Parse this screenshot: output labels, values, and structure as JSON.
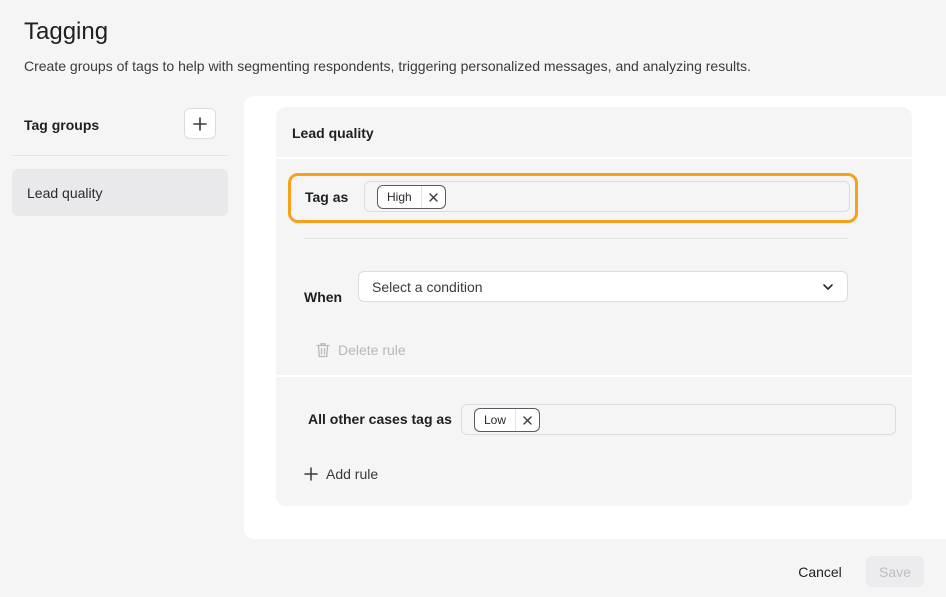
{
  "header": {
    "title": "Tagging",
    "subtitle": "Create groups of tags to help with segmenting respondents, triggering personalized messages, and analyzing results."
  },
  "sidebar": {
    "heading": "Tag groups",
    "add_icon": "plus-icon",
    "items": [
      {
        "label": "Lead quality",
        "selected": true
      }
    ]
  },
  "group": {
    "title": "Lead quality",
    "rule": {
      "tag_as_label": "Tag as",
      "tags": [
        {
          "label": "High",
          "remove_icon": "close-icon"
        }
      ],
      "when_label": "When",
      "condition_placeholder": "Select a condition",
      "condition_icon": "chevron-down-icon",
      "delete_label": "Delete rule",
      "delete_icon": "trash-icon"
    },
    "otherwise": {
      "label": "All other cases tag as",
      "tags": [
        {
          "label": "Low",
          "remove_icon": "close-icon"
        }
      ]
    },
    "add_rule_label": "Add rule",
    "add_rule_icon": "plus-icon"
  },
  "footer": {
    "cancel_label": "Cancel",
    "save_label": "Save"
  },
  "colors": {
    "background": "#f5f5f6",
    "highlight": "#f7a11a",
    "panel": "#ffffff",
    "disabled_text": "#b8b8bd"
  }
}
